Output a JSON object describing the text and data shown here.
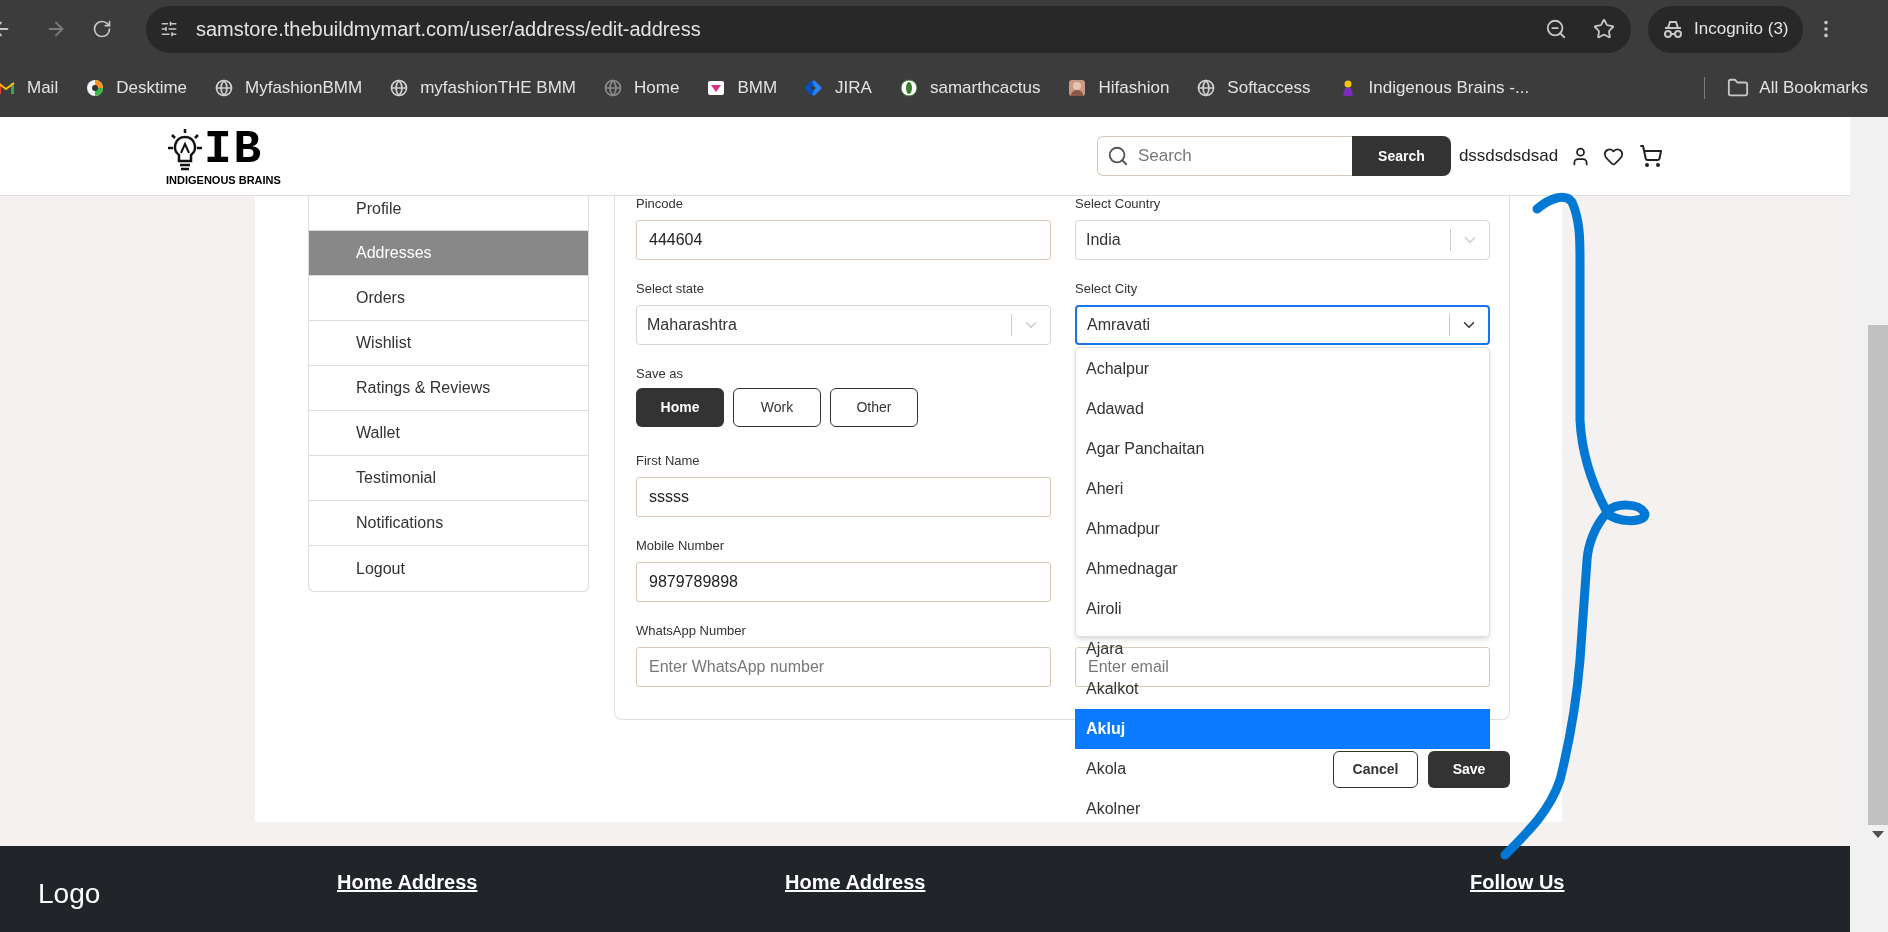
{
  "browser": {
    "url": "samstore.thebuildmymart.com/user/address/edit-address",
    "profile": "Incognito (3)",
    "bookmarks": [
      {
        "label": "Mail"
      },
      {
        "label": "Desktime"
      },
      {
        "label": "MyfashionBMM"
      },
      {
        "label": "myfashionTHE BMM"
      },
      {
        "label": "Home"
      },
      {
        "label": "BMM"
      },
      {
        "label": "JIRA"
      },
      {
        "label": "samarthcactus"
      },
      {
        "label": "Hifashion"
      },
      {
        "label": "Softaccess"
      },
      {
        "label": "Indigenous Brains -..."
      }
    ],
    "all_bookmarks": "All Bookmarks"
  },
  "header": {
    "logo": {
      "mark": "IB",
      "text": "INDIGENOUS BRAINS"
    },
    "search": {
      "placeholder": "Search",
      "button": "Search"
    },
    "username": "dssdsdsdsad"
  },
  "sidebar": {
    "items": [
      {
        "label": "Profile",
        "selected": false
      },
      {
        "label": "Addresses",
        "selected": true
      },
      {
        "label": "Orders",
        "selected": false
      },
      {
        "label": "Wishlist",
        "selected": false
      },
      {
        "label": "Ratings & Reviews",
        "selected": false
      },
      {
        "label": "Wallet",
        "selected": false
      },
      {
        "label": "Testimonial",
        "selected": false
      },
      {
        "label": "Notifications",
        "selected": false
      },
      {
        "label": "Logout",
        "selected": false
      }
    ]
  },
  "form": {
    "rows": [
      {
        "left": {
          "kind": "text",
          "label": "Pincode",
          "value": "444604"
        },
        "right": {
          "kind": "select",
          "label": "Select Country",
          "value": "India",
          "open": false
        }
      },
      {
        "left": {
          "kind": "select",
          "label": "Select state",
          "value": "Maharashtra",
          "open": false
        },
        "right": {
          "kind": "select",
          "label": "Select City",
          "value": "Amravati",
          "open": true,
          "options": [
            {
              "label": "Achalpur",
              "selected": false
            },
            {
              "label": "Adawad",
              "selected": false
            },
            {
              "label": "Agar Panchaitan",
              "selected": false
            },
            {
              "label": "Aheri",
              "selected": false
            },
            {
              "label": "Ahmadpur",
              "selected": false
            },
            {
              "label": "Ahmednagar",
              "selected": false
            },
            {
              "label": "Airoli",
              "selected": false
            },
            {
              "label": "Ajara",
              "selected": false
            },
            {
              "label": "Akalkot",
              "selected": false
            },
            {
              "label": "Akluj",
              "selected": true
            },
            {
              "label": "Akola",
              "selected": false
            },
            {
              "label": "Akolner",
              "selected": false
            }
          ]
        }
      },
      {
        "left": {
          "kind": "choice",
          "label": "Save as",
          "options": [
            {
              "label": "Home",
              "selected": true
            },
            {
              "label": "Work",
              "selected": false
            },
            {
              "label": "Other",
              "selected": false
            }
          ]
        }
      },
      {
        "left": {
          "kind": "text",
          "label": "First Name",
          "value": "sssss"
        }
      },
      {
        "left": {
          "kind": "text",
          "label": "Mobile Number",
          "value": "9879789898"
        }
      },
      {
        "left": {
          "kind": "text",
          "label": "WhatsApp Number",
          "placeholder": "Enter WhatsApp number"
        },
        "right": {
          "kind": "text",
          "placeholder": "Enter email"
        }
      }
    ],
    "actions": [
      {
        "label": "Cancel",
        "kind": "secondary"
      },
      {
        "label": "Save",
        "kind": "primary"
      }
    ]
  },
  "footer": {
    "logo": "Logo",
    "links": [
      "Home Address",
      "Home Address",
      "Follow Us"
    ]
  }
}
